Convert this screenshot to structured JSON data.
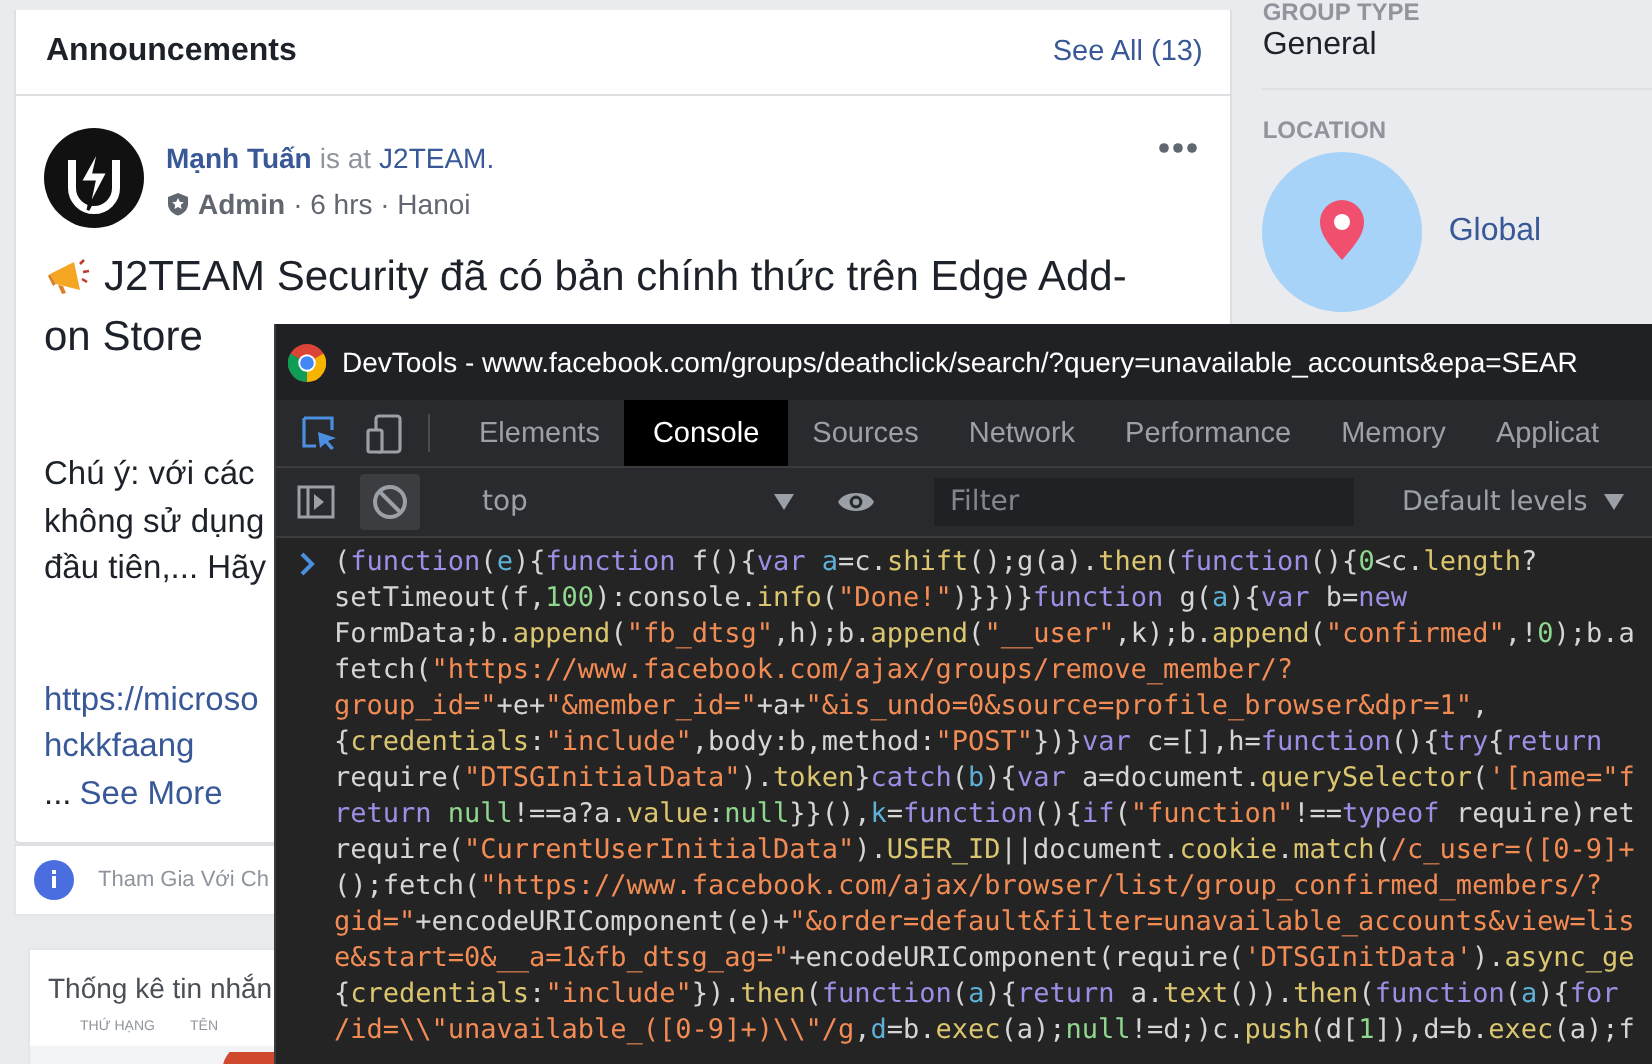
{
  "feed": {
    "header": {
      "title": "Announcements",
      "see_all": "See All (13)"
    },
    "post": {
      "author": "Mạnh Tuấn",
      "is_at": "is at",
      "place": "J2TEAM.",
      "role": "Admin",
      "meta": "· 6 hrs · Hanoi",
      "title_lines": [
        "J2TEAM Security đã có bản chính thức trên Edge Add-",
        "on Store"
      ],
      "body_lines": [
        "Chú ý: với các",
        "không sử dụng",
        "đầu tiên,... Hãy"
      ],
      "link_lines": [
        "https://microso",
        "hckkfaang"
      ],
      "ellipsis": "...",
      "see_more": "See More"
    },
    "join_bar": {
      "text": "Tham Gia Với Ch"
    },
    "stats": {
      "title": "Thống kê tin nhắn",
      "columns": [
        "THỨ HẠNG",
        "TÊN"
      ]
    }
  },
  "sidebar": {
    "group_type": {
      "label": "GROUP TYPE",
      "value": "General"
    },
    "location": {
      "label": "LOCATION",
      "value": "Global"
    }
  },
  "devtools": {
    "title": "DevTools - www.facebook.com/groups/deathclick/search/?query=unavailable_accounts&epa=SEAR",
    "tabs": [
      {
        "label": "Elements",
        "selected": false
      },
      {
        "label": "Console",
        "selected": true
      },
      {
        "label": "Sources",
        "selected": false
      },
      {
        "label": "Network",
        "selected": false
      },
      {
        "label": "Performance",
        "selected": false
      },
      {
        "label": "Memory",
        "selected": false
      },
      {
        "label": "Applicat",
        "selected": false
      }
    ],
    "toolbar": {
      "context": "top",
      "filter_placeholder": "Filter",
      "levels": "Default levels"
    },
    "lines": [
      {
        "tokens": [
          {
            "kind": "plain",
            "text": "("
          },
          {
            "kind": "kw",
            "text": "function"
          },
          {
            "kind": "plain",
            "text": "("
          },
          {
            "kind": "var",
            "text": "e"
          },
          {
            "kind": "plain",
            "text": "){"
          },
          {
            "kind": "kw",
            "text": "function"
          },
          {
            "kind": "plain",
            "text": " f(){"
          },
          {
            "kind": "kw",
            "text": "var "
          },
          {
            "kind": "var",
            "text": "a"
          },
          {
            "kind": "plain",
            "text": "=c."
          },
          {
            "kind": "fn",
            "text": "shift"
          },
          {
            "kind": "plain",
            "text": "();g(a)."
          },
          {
            "kind": "fn",
            "text": "then"
          },
          {
            "kind": "plain",
            "text": "("
          },
          {
            "kind": "kw",
            "text": "function"
          },
          {
            "kind": "plain",
            "text": "(){"
          },
          {
            "kind": "num",
            "text": "0"
          },
          {
            "kind": "plain",
            "text": "<c."
          },
          {
            "kind": "fn",
            "text": "length"
          },
          {
            "kind": "plain",
            "text": "?"
          }
        ]
      },
      {
        "tokens": [
          {
            "kind": "plain",
            "text": "setTimeout(f,"
          },
          {
            "kind": "num",
            "text": "100"
          },
          {
            "kind": "plain",
            "text": "):console."
          },
          {
            "kind": "fn",
            "text": "info"
          },
          {
            "kind": "plain",
            "text": "("
          },
          {
            "kind": "str",
            "text": "\"Done!\""
          },
          {
            "kind": "plain",
            "text": ")}})}"
          },
          {
            "kind": "kw",
            "text": "function"
          },
          {
            "kind": "plain",
            "text": " g("
          },
          {
            "kind": "var",
            "text": "a"
          },
          {
            "kind": "plain",
            "text": "){"
          },
          {
            "kind": "kw",
            "text": "var"
          },
          {
            "kind": "plain",
            "text": " b="
          },
          {
            "kind": "kw",
            "text": "new"
          }
        ]
      },
      {
        "tokens": [
          {
            "kind": "plain",
            "text": "FormData;b."
          },
          {
            "kind": "fn",
            "text": "append"
          },
          {
            "kind": "plain",
            "text": "("
          },
          {
            "kind": "str",
            "text": "\"fb_dtsg\""
          },
          {
            "kind": "plain",
            "text": ",h);b."
          },
          {
            "kind": "fn",
            "text": "append"
          },
          {
            "kind": "plain",
            "text": "("
          },
          {
            "kind": "str",
            "text": "\"__user\""
          },
          {
            "kind": "plain",
            "text": ",k);b."
          },
          {
            "kind": "fn",
            "text": "append"
          },
          {
            "kind": "plain",
            "text": "("
          },
          {
            "kind": "str",
            "text": "\"confirmed\""
          },
          {
            "kind": "plain",
            "text": ",!"
          },
          {
            "kind": "num",
            "text": "0"
          },
          {
            "kind": "plain",
            "text": ");b.a"
          }
        ]
      },
      {
        "tokens": [
          {
            "kind": "plain",
            "text": "fetch("
          },
          {
            "kind": "str",
            "text": "\"https://www.facebook.com/ajax/groups/remove_member/?"
          }
        ]
      },
      {
        "tokens": [
          {
            "kind": "str",
            "text": "group_id=\""
          },
          {
            "kind": "plain",
            "text": "+e+"
          },
          {
            "kind": "str",
            "text": "\"&member_id=\""
          },
          {
            "kind": "plain",
            "text": "+a+"
          },
          {
            "kind": "str",
            "text": "\"&is_undo=0&source=profile_browser&dpr=1\""
          },
          {
            "kind": "plain",
            "text": ","
          }
        ]
      },
      {
        "tokens": [
          {
            "kind": "plain",
            "text": "{"
          },
          {
            "kind": "fn",
            "text": "credentials"
          },
          {
            "kind": "plain",
            "text": ":"
          },
          {
            "kind": "str",
            "text": "\"include\""
          },
          {
            "kind": "plain",
            "text": ",body:b,method:"
          },
          {
            "kind": "str",
            "text": "\"POST\""
          },
          {
            "kind": "plain",
            "text": "})}"
          },
          {
            "kind": "kw",
            "text": "var"
          },
          {
            "kind": "plain",
            "text": " c=[],h="
          },
          {
            "kind": "kw",
            "text": "function"
          },
          {
            "kind": "plain",
            "text": "(){"
          },
          {
            "kind": "kw",
            "text": "try"
          },
          {
            "kind": "plain",
            "text": "{"
          },
          {
            "kind": "kw",
            "text": "return"
          }
        ]
      },
      {
        "tokens": [
          {
            "kind": "plain",
            "text": "require("
          },
          {
            "kind": "str",
            "text": "\"DTSGInitialData\""
          },
          {
            "kind": "plain",
            "text": ")."
          },
          {
            "kind": "fn",
            "text": "token"
          },
          {
            "kind": "plain",
            "text": "}"
          },
          {
            "kind": "kw",
            "text": "catch"
          },
          {
            "kind": "plain",
            "text": "("
          },
          {
            "kind": "var",
            "text": "b"
          },
          {
            "kind": "plain",
            "text": "){"
          },
          {
            "kind": "kw",
            "text": "var"
          },
          {
            "kind": "plain",
            "text": " a=document."
          },
          {
            "kind": "fn",
            "text": "querySelector"
          },
          {
            "kind": "plain",
            "text": "("
          },
          {
            "kind": "str",
            "text": "'[name=\"f"
          }
        ]
      },
      {
        "tokens": [
          {
            "kind": "kw",
            "text": "return "
          },
          {
            "kind": "num",
            "text": "null"
          },
          {
            "kind": "plain",
            "text": "!==a?a."
          },
          {
            "kind": "fn",
            "text": "value"
          },
          {
            "kind": "plain",
            "text": ":"
          },
          {
            "kind": "num",
            "text": "null"
          },
          {
            "kind": "plain",
            "text": "}}(),"
          },
          {
            "kind": "var",
            "text": "k"
          },
          {
            "kind": "plain",
            "text": "="
          },
          {
            "kind": "kw",
            "text": "function"
          },
          {
            "kind": "plain",
            "text": "(){"
          },
          {
            "kind": "kw",
            "text": "if"
          },
          {
            "kind": "plain",
            "text": "("
          },
          {
            "kind": "str",
            "text": "\"function\""
          },
          {
            "kind": "plain",
            "text": "!=="
          },
          {
            "kind": "kw",
            "text": "typeof"
          },
          {
            "kind": "plain",
            "text": " require)ret"
          }
        ]
      },
      {
        "tokens": [
          {
            "kind": "plain",
            "text": "require("
          },
          {
            "kind": "str",
            "text": "\"CurrentUserInitialData\""
          },
          {
            "kind": "plain",
            "text": ")."
          },
          {
            "kind": "fn",
            "text": "USER_ID"
          },
          {
            "kind": "plain",
            "text": "||document."
          },
          {
            "kind": "fn",
            "text": "cookie"
          },
          {
            "kind": "plain",
            "text": "."
          },
          {
            "kind": "fn",
            "text": "match"
          },
          {
            "kind": "plain",
            "text": "("
          },
          {
            "kind": "str",
            "text": "/c_user=([0-9]+"
          }
        ]
      },
      {
        "tokens": [
          {
            "kind": "plain",
            "text": "();fetch("
          },
          {
            "kind": "str",
            "text": "\"https://www.facebook.com/ajax/browser/list/group_confirmed_members/?"
          }
        ]
      },
      {
        "tokens": [
          {
            "kind": "str",
            "text": "gid=\""
          },
          {
            "kind": "plain",
            "text": "+encodeURIComponent(e)+"
          },
          {
            "kind": "str",
            "text": "\"&order=default&filter=unavailable_accounts&view=lis"
          }
        ]
      },
      {
        "tokens": [
          {
            "kind": "str",
            "text": "e&start=0&__a=1&fb_dtsg_ag=\""
          },
          {
            "kind": "plain",
            "text": "+encodeURIComponent(require("
          },
          {
            "kind": "str",
            "text": "'DTSGInitData'"
          },
          {
            "kind": "plain",
            "text": ")."
          },
          {
            "kind": "fn",
            "text": "async_ge"
          }
        ]
      },
      {
        "tokens": [
          {
            "kind": "plain",
            "text": "{"
          },
          {
            "kind": "fn",
            "text": "credentials"
          },
          {
            "kind": "plain",
            "text": ":"
          },
          {
            "kind": "str",
            "text": "\"include\""
          },
          {
            "kind": "plain",
            "text": "})."
          },
          {
            "kind": "fn",
            "text": "then"
          },
          {
            "kind": "plain",
            "text": "("
          },
          {
            "kind": "kw",
            "text": "function"
          },
          {
            "kind": "plain",
            "text": "("
          },
          {
            "kind": "var",
            "text": "a"
          },
          {
            "kind": "plain",
            "text": "){"
          },
          {
            "kind": "kw",
            "text": "return"
          },
          {
            "kind": "plain",
            "text": " a."
          },
          {
            "kind": "fn",
            "text": "text"
          },
          {
            "kind": "plain",
            "text": "())."
          },
          {
            "kind": "fn",
            "text": "then"
          },
          {
            "kind": "plain",
            "text": "("
          },
          {
            "kind": "kw",
            "text": "function"
          },
          {
            "kind": "plain",
            "text": "("
          },
          {
            "kind": "var",
            "text": "a"
          },
          {
            "kind": "plain",
            "text": "){"
          },
          {
            "kind": "kw",
            "text": "for"
          }
        ]
      },
      {
        "tokens": [
          {
            "kind": "str",
            "text": "/id=\\\\\"unavailable_([0-9]+)\\\\\"/g"
          },
          {
            "kind": "plain",
            "text": ","
          },
          {
            "kind": "var",
            "text": "d"
          },
          {
            "kind": "plain",
            "text": "=b."
          },
          {
            "kind": "fn",
            "text": "exec"
          },
          {
            "kind": "plain",
            "text": "(a);"
          },
          {
            "kind": "num",
            "text": "null"
          },
          {
            "kind": "plain",
            "text": "!=d;)c."
          },
          {
            "kind": "fn",
            "text": "push"
          },
          {
            "kind": "plain",
            "text": "(d["
          },
          {
            "kind": "num",
            "text": "1"
          },
          {
            "kind": "plain",
            "text": "]),d=b."
          },
          {
            "kind": "fn",
            "text": "exec"
          },
          {
            "kind": "plain",
            "text": "(a);f"
          }
        ]
      }
    ]
  }
}
